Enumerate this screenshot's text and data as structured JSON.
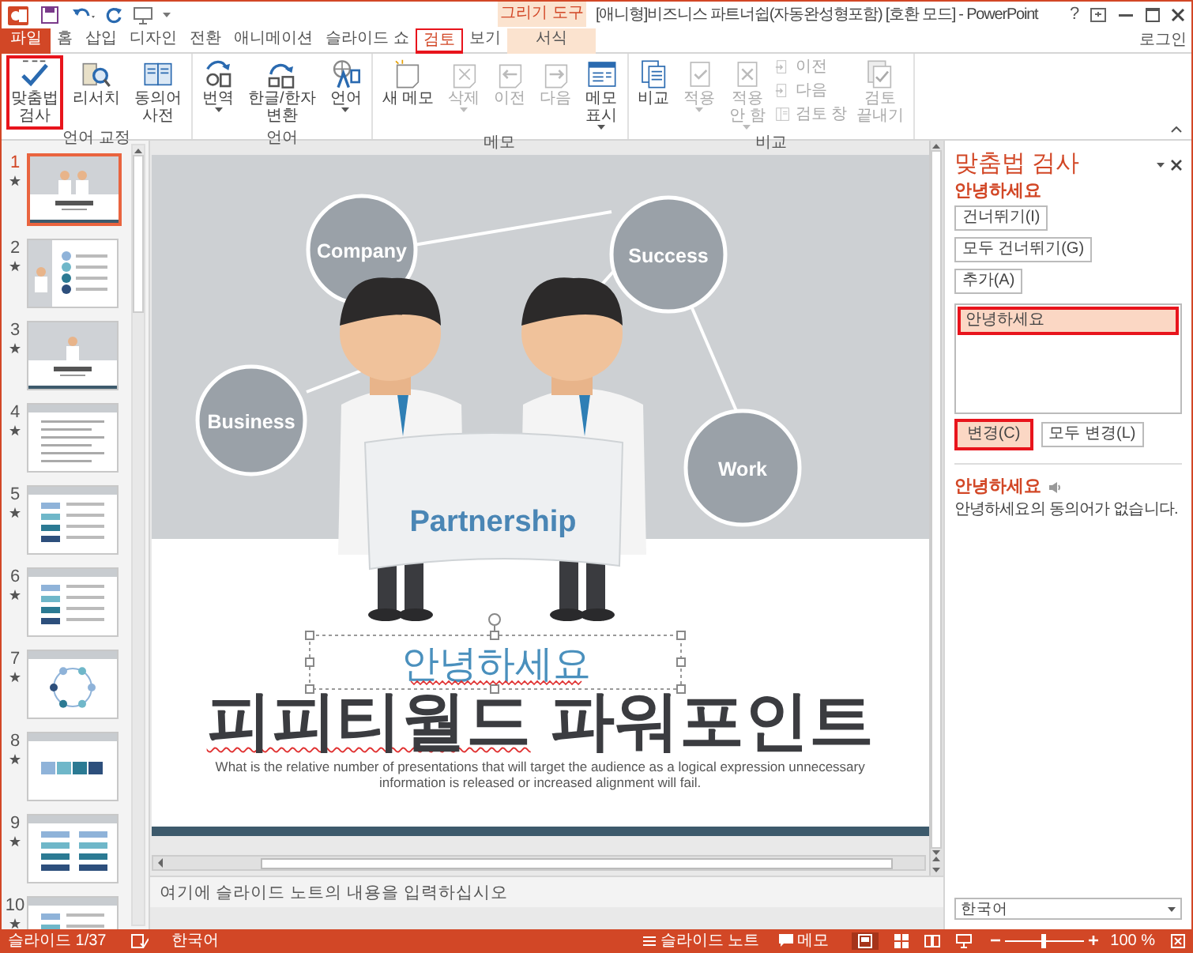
{
  "window": {
    "title": "[애니형]비즈니스 파트너쉽(자동완성형포함) [호환 모드] - PowerPoint",
    "context_group": "그리기 도구",
    "help": "?",
    "account": "로그인"
  },
  "tabs": [
    {
      "label": "파일",
      "kind": "file",
      "selected": false,
      "highlighted": false
    },
    {
      "label": "홈",
      "kind": "tab",
      "selected": false,
      "highlighted": false
    },
    {
      "label": "삽입",
      "kind": "tab",
      "selected": false,
      "highlighted": false
    },
    {
      "label": "디자인",
      "kind": "tab",
      "selected": false,
      "highlighted": false
    },
    {
      "label": "전환",
      "kind": "tab",
      "selected": false,
      "highlighted": false
    },
    {
      "label": "애니메이션",
      "kind": "tab",
      "selected": false,
      "highlighted": false
    },
    {
      "label": "슬라이드 쇼",
      "kind": "tab",
      "selected": false,
      "highlighted": false
    },
    {
      "label": "검토",
      "kind": "tab",
      "selected": true,
      "highlighted": true
    },
    {
      "label": "보기",
      "kind": "tab",
      "selected": false,
      "highlighted": false
    },
    {
      "label": "서식",
      "kind": "context",
      "selected": false,
      "highlighted": false
    }
  ],
  "ribbon": [
    {
      "label": "언어 교정",
      "buttons": [
        {
          "kind": "large",
          "lines": [
            "맞춤법",
            "검사"
          ],
          "disabled": false,
          "dropdown": false,
          "highlighted": true
        },
        {
          "kind": "large",
          "lines": [
            "리서치"
          ],
          "disabled": false,
          "dropdown": false,
          "highlighted": false
        },
        {
          "kind": "large",
          "lines": [
            "동의어",
            "사전"
          ],
          "disabled": false,
          "dropdown": false,
          "highlighted": false
        }
      ]
    },
    {
      "label": "언어",
      "buttons": [
        {
          "kind": "large",
          "lines": [
            "번역"
          ],
          "disabled": false,
          "dropdown": true,
          "highlighted": false
        },
        {
          "kind": "large",
          "lines": [
            "한글/한자",
            "변환"
          ],
          "disabled": false,
          "dropdown": false,
          "highlighted": false
        },
        {
          "kind": "large",
          "lines": [
            "언어"
          ],
          "disabled": false,
          "dropdown": true,
          "highlighted": false
        }
      ]
    },
    {
      "label": "메모",
      "buttons": [
        {
          "kind": "large",
          "lines": [
            "새 메모"
          ],
          "disabled": false,
          "dropdown": false,
          "highlighted": false
        },
        {
          "kind": "large",
          "lines": [
            "삭제"
          ],
          "disabled": true,
          "dropdown": true,
          "highlighted": false
        },
        {
          "kind": "large",
          "lines": [
            "이전"
          ],
          "disabled": true,
          "dropdown": false,
          "highlighted": false
        },
        {
          "kind": "large",
          "lines": [
            "다음"
          ],
          "disabled": true,
          "dropdown": false,
          "highlighted": false
        },
        {
          "kind": "large",
          "lines": [
            "메모",
            "표시"
          ],
          "disabled": false,
          "dropdown": true,
          "highlighted": false
        }
      ]
    },
    {
      "label": "비교",
      "buttons": [
        {
          "kind": "large",
          "lines": [
            "비교"
          ],
          "disabled": false,
          "dropdown": false,
          "highlighted": false
        },
        {
          "kind": "large",
          "lines": [
            "적용"
          ],
          "disabled": true,
          "dropdown": true,
          "highlighted": false
        },
        {
          "kind": "large",
          "lines": [
            "적용",
            "안 함"
          ],
          "disabled": true,
          "dropdown": true,
          "highlighted": false
        },
        {
          "kind": "small",
          "lines": [
            "이전"
          ],
          "disabled": true,
          "dropdown": false,
          "highlighted": false
        },
        {
          "kind": "small",
          "lines": [
            "다음"
          ],
          "disabled": true,
          "dropdown": false,
          "highlighted": false
        },
        {
          "kind": "small",
          "lines": [
            "검토 창"
          ],
          "disabled": true,
          "dropdown": false,
          "highlighted": false
        },
        {
          "kind": "large",
          "lines": [
            "검토",
            "끝내기"
          ],
          "disabled": true,
          "dropdown": false,
          "highlighted": false
        }
      ]
    }
  ],
  "thumbnails": [
    {
      "number": "1",
      "selected": true
    },
    {
      "number": "2",
      "selected": false
    },
    {
      "number": "3",
      "selected": false
    },
    {
      "number": "4",
      "selected": false
    },
    {
      "number": "5",
      "selected": false
    },
    {
      "number": "6",
      "selected": false
    },
    {
      "number": "7",
      "selected": false
    },
    {
      "number": "8",
      "selected": false
    },
    {
      "number": "9",
      "selected": false
    },
    {
      "number": "10",
      "selected": false
    }
  ],
  "slide": {
    "bubbles": [
      "Company",
      "Success",
      "Business",
      "Work"
    ],
    "sign": "Partnership",
    "textbox": {
      "text": "안녕하세요",
      "spelling_error": true
    },
    "title": [
      {
        "text": "피피티월드",
        "spelling_error": true
      },
      {
        "text": "파워포인트",
        "spelling_error": false
      }
    ],
    "subtitle": "What is the relative number of presentations that will target the audience as a logical expression unnecessary information is released  or  increased alignment will fail."
  },
  "notes": {
    "placeholder": "여기에 슬라이드 노트의 내용을 입력하십시오"
  },
  "spell_pane": {
    "title": "맞춤법 검사",
    "word": "안녕하세요",
    "buttons": [
      {
        "label": "건너뛰기(I)",
        "highlighted": false
      },
      {
        "label": "모두 건너뛰기(G)",
        "highlighted": false
      },
      {
        "label": "추가(A)",
        "highlighted": false
      }
    ],
    "suggestions": [
      {
        "text": "안녕하세요",
        "selected": true,
        "highlighted": true
      }
    ],
    "change_buttons": [
      {
        "label": "변경(C)",
        "highlighted": true
      },
      {
        "label": "모두 변경(L)",
        "highlighted": false
      }
    ],
    "synonym_word": "안녕하세요",
    "synonym_message": "안녕하세요의 동의어가 없습니다.",
    "language": "한국어"
  },
  "status_bar": {
    "slide": "슬라이드 1/37",
    "language": "한국어",
    "notes": "슬라이드 노트",
    "comments": "메모",
    "zoom": "100 %",
    "zoom_slider": {
      "level": 0.5
    }
  }
}
